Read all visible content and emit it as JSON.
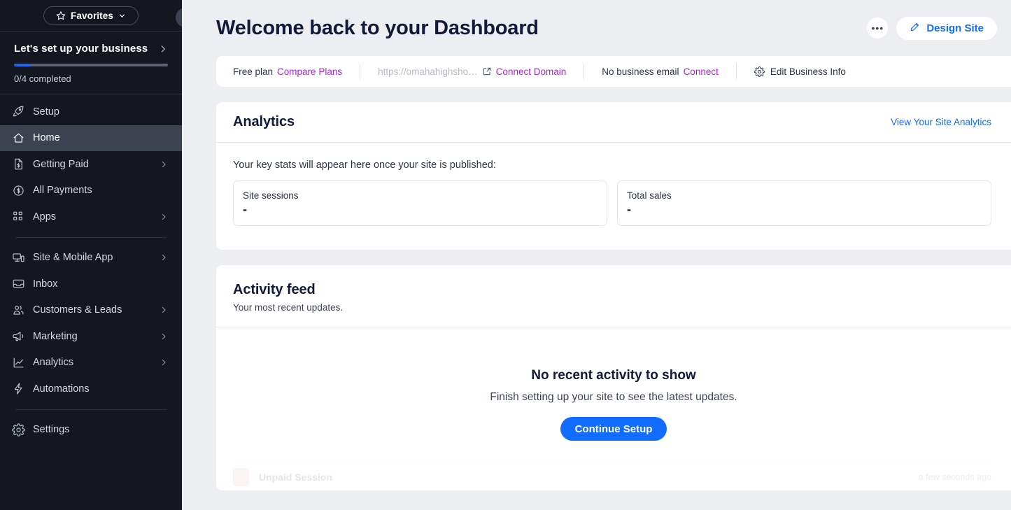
{
  "sidebar": {
    "favorites_label": "Favorites",
    "favorites_icon": "star-icon",
    "favorites_chevron": "chevron-down-icon",
    "setup": {
      "title": "Let's set up your business",
      "chevron": "chevron-right-icon",
      "progress_percent": 11,
      "progress_text": "0/4 completed"
    },
    "items": [
      {
        "label": "Setup",
        "icon": "rocket-icon",
        "has_arrow": false,
        "active": false
      },
      {
        "label": "Home",
        "icon": "home-icon",
        "has_arrow": false,
        "active": true
      },
      {
        "label": "Getting Paid",
        "icon": "invoice-icon",
        "has_arrow": true,
        "active": false
      },
      {
        "label": "All Payments",
        "icon": "coin-icon",
        "has_arrow": false,
        "active": false
      },
      {
        "label": "Apps",
        "icon": "apps-icon",
        "has_arrow": true,
        "active": false
      }
    ],
    "items2": [
      {
        "label": "Site & Mobile App",
        "icon": "devices-icon",
        "has_arrow": true,
        "active": false
      },
      {
        "label": "Inbox",
        "icon": "inbox-icon",
        "has_arrow": false,
        "active": false
      },
      {
        "label": "Customers & Leads",
        "icon": "people-icon",
        "has_arrow": true,
        "active": false
      },
      {
        "label": "Marketing",
        "icon": "megaphone-icon",
        "has_arrow": true,
        "active": false
      },
      {
        "label": "Analytics",
        "icon": "chart-icon",
        "has_arrow": true,
        "active": false
      },
      {
        "label": "Automations",
        "icon": "bolt-icon",
        "has_arrow": false,
        "active": false
      }
    ],
    "items3": [
      {
        "label": "Settings",
        "icon": "gear-icon",
        "has_arrow": false,
        "active": false
      }
    ],
    "collapse_icon": "chevron-left-icon"
  },
  "header": {
    "title": "Welcome back to your Dashboard",
    "more_button_icon": "ellipsis-icon",
    "more_button_label": "•••",
    "design_site_label": "Design Site",
    "design_site_icon": "pencil-icon"
  },
  "infobar": {
    "plan_text": "Free plan",
    "compare_plans_label": "Compare Plans",
    "site_url": "https://omahahighsho…",
    "external_link_icon": "external-link-icon",
    "connect_domain_label": "Connect Domain",
    "business_email_text": "No business email",
    "connect_label": "Connect",
    "edit_business_label": "Edit Business Info",
    "edit_business_icon": "gear-icon"
  },
  "analytics": {
    "title": "Analytics",
    "view_link": "View Your Site Analytics",
    "subtitle": "Your key stats will appear here once your site is published:",
    "stats": [
      {
        "label": "Site sessions",
        "value": "-"
      },
      {
        "label": "Total sales",
        "value": "-"
      }
    ]
  },
  "activity": {
    "title": "Activity feed",
    "subtitle": "Your most recent updates.",
    "empty_title": "No recent activity to show",
    "empty_subtitle": "Finish setting up your site to see the latest updates.",
    "cta_label": "Continue Setup",
    "ghost_row": {
      "label": "Unpaid Session",
      "time": "a few seconds ago",
      "icon": "session-avatar-icon"
    }
  },
  "colors": {
    "sidebar_bg": "#14171f",
    "page_bg": "#eceef2",
    "accent_blue": "#116dff",
    "accent_purple": "#aa27d8",
    "title_ink": "#131938",
    "active_nav": "#3c4250"
  }
}
